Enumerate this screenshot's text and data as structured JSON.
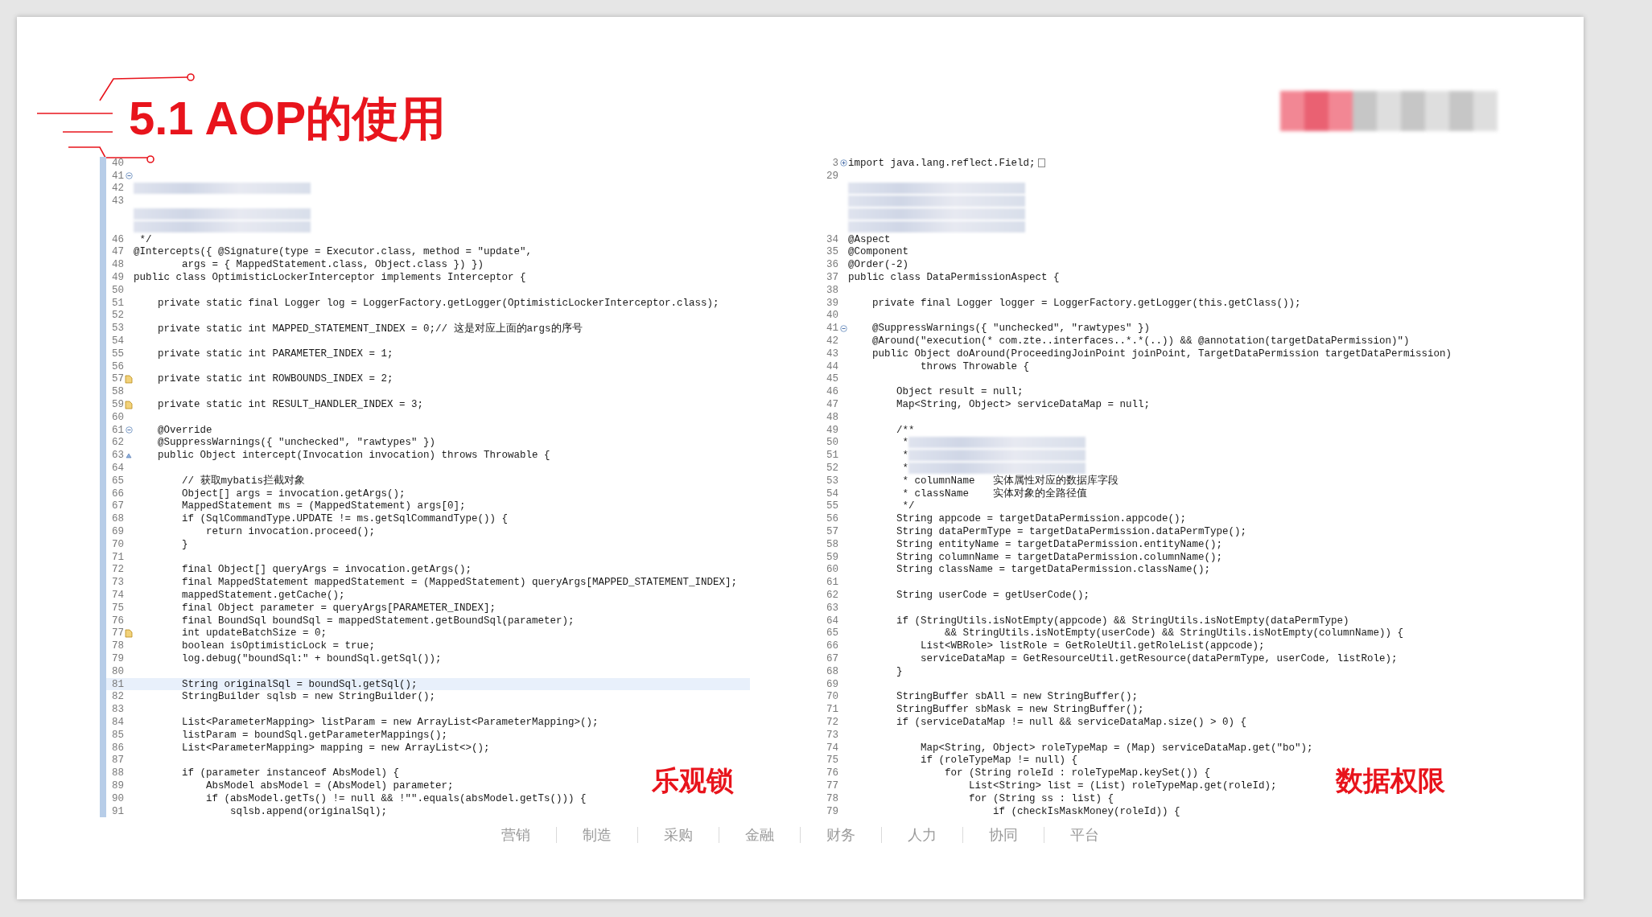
{
  "slide": {
    "title": "5.1 AOP的使用"
  },
  "panels": [
    {
      "caption": "乐观锁",
      "ruler": true,
      "lines": [
        {
          "num": "40",
          "current": false
        },
        {
          "num": "41",
          "icon": {
            "kind": "fold"
          },
          "current": false
        },
        {
          "num": "42",
          "kind": "redacted",
          "current": false
        },
        {
          "num": "43",
          "current": false
        },
        {
          "kind": "redacted",
          "current": false
        },
        {
          "kind": "redacted",
          "current": false
        },
        {
          "num": "46",
          "text": " */",
          "current": false
        },
        {
          "num": "47",
          "text": "@Intercepts({ @Signature(type = Executor.class, method = \"update\",",
          "current": false
        },
        {
          "num": "48",
          "text": "        args = { MappedStatement.class, Object.class }) })",
          "current": false
        },
        {
          "num": "49",
          "text": "public class OptimisticLockerInterceptor implements Interceptor {",
          "current": false
        },
        {
          "num": "50",
          "current": false
        },
        {
          "num": "51",
          "text": "    private static final Logger log = LoggerFactory.getLogger(OptimisticLockerInterceptor.class);",
          "current": false
        },
        {
          "num": "52",
          "current": false
        },
        {
          "num": "53",
          "text": "    private static int MAPPED_STATEMENT_INDEX = 0;// 这是对应上面的args的序号",
          "current": false
        },
        {
          "num": "54",
          "current": false
        },
        {
          "num": "55",
          "text": "    private static int PARAMETER_INDEX = 1;",
          "current": false
        },
        {
          "num": "56",
          "current": false
        },
        {
          "num": "57",
          "icon": {
            "kind": "warning"
          },
          "text": "    private static int ROWBOUNDS_INDEX = 2;",
          "current": false
        },
        {
          "num": "58",
          "current": false
        },
        {
          "num": "59",
          "icon": {
            "kind": "warning"
          },
          "text": "    private static int RESULT_HANDLER_INDEX = 3;",
          "current": false
        },
        {
          "num": "60",
          "current": false
        },
        {
          "num": "61",
          "icon": {
            "kind": "fold"
          },
          "text": "    @Override",
          "current": false
        },
        {
          "num": "62",
          "text": "    @SuppressWarnings({ \"unchecked\", \"rawtypes\" })",
          "current": false
        },
        {
          "num": "63",
          "icon": {
            "kind": "override"
          },
          "text": "    public Object intercept(Invocation invocation) throws Throwable {",
          "current": false
        },
        {
          "num": "64",
          "current": false
        },
        {
          "num": "65",
          "text": "        // 获取mybatis拦截对象",
          "current": false
        },
        {
          "num": "66",
          "text": "        Object[] args = invocation.getArgs();",
          "current": false
        },
        {
          "num": "67",
          "text": "        MappedStatement ms = (MappedStatement) args[0];",
          "current": false
        },
        {
          "num": "68",
          "text": "        if (SqlCommandType.UPDATE != ms.getSqlCommandType()) {",
          "current": false
        },
        {
          "num": "69",
          "text": "            return invocation.proceed();",
          "current": false
        },
        {
          "num": "70",
          "text": "        }",
          "current": false
        },
        {
          "num": "71",
          "current": false
        },
        {
          "num": "72",
          "text": "        final Object[] queryArgs = invocation.getArgs();",
          "current": false
        },
        {
          "num": "73",
          "text": "        final MappedStatement mappedStatement = (MappedStatement) queryArgs[MAPPED_STATEMENT_INDEX];",
          "current": false
        },
        {
          "num": "74",
          "text": "        mappedStatement.getCache();",
          "current": false
        },
        {
          "num": "75",
          "text": "        final Object parameter = queryArgs[PARAMETER_INDEX];",
          "current": false
        },
        {
          "num": "76",
          "text": "        final BoundSql boundSql = mappedStatement.getBoundSql(parameter);",
          "current": false
        },
        {
          "num": "77",
          "icon": {
            "kind": "warning"
          },
          "text": "        int updateBatchSize = 0;",
          "current": false
        },
        {
          "num": "78",
          "text": "        boolean isOptimisticLock = true;",
          "current": false
        },
        {
          "num": "79",
          "text": "        log.debug(\"boundSql:\" + boundSql.getSql());",
          "current": false
        },
        {
          "num": "80",
          "current": false
        },
        {
          "num": "81",
          "text": "        String originalSql = boundSql.getSql();",
          "current": true
        },
        {
          "num": "82",
          "text": "        StringBuilder sqlsb = new StringBuilder();",
          "current": false
        },
        {
          "num": "83",
          "current": false
        },
        {
          "num": "84",
          "text": "        List<ParameterMapping> listParam = new ArrayList<ParameterMapping>();",
          "current": false
        },
        {
          "num": "85",
          "text": "        listParam = boundSql.getParameterMappings();",
          "current": false
        },
        {
          "num": "86",
          "text": "        List<ParameterMapping> mapping = new ArrayList<>();",
          "current": false
        },
        {
          "num": "87",
          "current": false
        },
        {
          "num": "88",
          "text": "        if (parameter instanceof AbsModel) {",
          "current": false
        },
        {
          "num": "89",
          "text": "            AbsModel absModel = (AbsModel) parameter;",
          "current": false
        },
        {
          "num": "90",
          "text": "            if (absModel.getTs() != null && !\"\".equals(absModel.getTs())) {",
          "current": false
        },
        {
          "num": "91",
          "text": "                sqlsb.append(originalSql);",
          "current": false
        }
      ]
    },
    {
      "caption": "数据权限",
      "ruler": false,
      "lines": [
        {
          "num": "3",
          "icon": {
            "kind": "expand"
          },
          "text": "import java.lang.reflect.Field;"
        },
        {
          "num": "29"
        },
        {
          "kind": "redacted"
        },
        {
          "kind": "redacted"
        },
        {
          "kind": "redacted"
        },
        {
          "kind": "redacted"
        },
        {
          "num": "34",
          "text": "@Aspect"
        },
        {
          "num": "35",
          "text": "@Component"
        },
        {
          "num": "36",
          "text": "@Order(-2)"
        },
        {
          "num": "37",
          "text": "public class DataPermissionAspect {"
        },
        {
          "num": "38"
        },
        {
          "num": "39",
          "text": "    private final Logger logger = LoggerFactory.getLogger(this.getClass());"
        },
        {
          "num": "40"
        },
        {
          "num": "41",
          "icon": {
            "kind": "fold"
          },
          "text": "    @SuppressWarnings({ \"unchecked\", \"rawtypes\" })"
        },
        {
          "num": "42",
          "text": "    @Around(\"execution(* com.zte..interfaces..*.*(..)) && @annotation(targetDataPermission)\")"
        },
        {
          "num": "43",
          "text": "    public Object doAround(ProceedingJoinPoint joinPoint, TargetDataPermission targetDataPermission)"
        },
        {
          "num": "44",
          "text": "            throws Throwable {"
        },
        {
          "num": "45"
        },
        {
          "num": "46",
          "text": "        Object result = null;"
        },
        {
          "num": "47",
          "text": "        Map<String, Object> serviceDataMap = null;"
        },
        {
          "num": "48"
        },
        {
          "num": "49",
          "text": "        /**"
        },
        {
          "num": "50",
          "kind": "redacted",
          "text": "         *"
        },
        {
          "num": "51",
          "kind": "redacted",
          "text": "         *"
        },
        {
          "num": "52",
          "kind": "redacted",
          "text": "         *"
        },
        {
          "num": "53",
          "text": "         * columnName   实体属性对应的数据库字段"
        },
        {
          "num": "54",
          "text": "         * className    实体对象的全路径值"
        },
        {
          "num": "55",
          "text": "         */"
        },
        {
          "num": "56",
          "text": "        String appcode = targetDataPermission.appcode();"
        },
        {
          "num": "57",
          "text": "        String dataPermType = targetDataPermission.dataPermType();"
        },
        {
          "num": "58",
          "text": "        String entityName = targetDataPermission.entityName();"
        },
        {
          "num": "59",
          "text": "        String columnName = targetDataPermission.columnName();"
        },
        {
          "num": "60",
          "text": "        String className = targetDataPermission.className();"
        },
        {
          "num": "61"
        },
        {
          "num": "62",
          "text": "        String userCode = getUserCode();"
        },
        {
          "num": "63"
        },
        {
          "num": "64",
          "text": "        if (StringUtils.isNotEmpty(appcode) && StringUtils.isNotEmpty(dataPermType)"
        },
        {
          "num": "65",
          "text": "                && StringUtils.isNotEmpty(userCode) && StringUtils.isNotEmpty(columnName)) {"
        },
        {
          "num": "66",
          "text": "            List<WBRole> listRole = GetRoleUtil.getRoleList(appcode);"
        },
        {
          "num": "67",
          "text": "            serviceDataMap = GetResourceUtil.getResource(dataPermType, userCode, listRole);"
        },
        {
          "num": "68",
          "text": "        }"
        },
        {
          "num": "69"
        },
        {
          "num": "70",
          "text": "        StringBuffer sbAll = new StringBuffer();"
        },
        {
          "num": "71",
          "text": "        StringBuffer sbMask = new StringBuffer();"
        },
        {
          "num": "72",
          "text": "        if (serviceDataMap != null && serviceDataMap.size() > 0) {"
        },
        {
          "num": "73"
        },
        {
          "num": "74",
          "text": "            Map<String, Object> roleTypeMap = (Map) serviceDataMap.get(\"bo\");"
        },
        {
          "num": "75",
          "text": "            if (roleTypeMap != null) {"
        },
        {
          "num": "76",
          "text": "                for (String roleId : roleTypeMap.keySet()) {"
        },
        {
          "num": "77",
          "text": "                    List<String> list = (List) roleTypeMap.get(roleId);"
        },
        {
          "num": "78",
          "text": "                    for (String ss : list) {"
        },
        {
          "num": "79",
          "text": "                        if (checkIsMaskMoney(roleId)) {"
        }
      ]
    }
  ],
  "footer_links": [
    "营销",
    "制造",
    "采购",
    "金融",
    "财务",
    "人力",
    "协同",
    "平台"
  ]
}
